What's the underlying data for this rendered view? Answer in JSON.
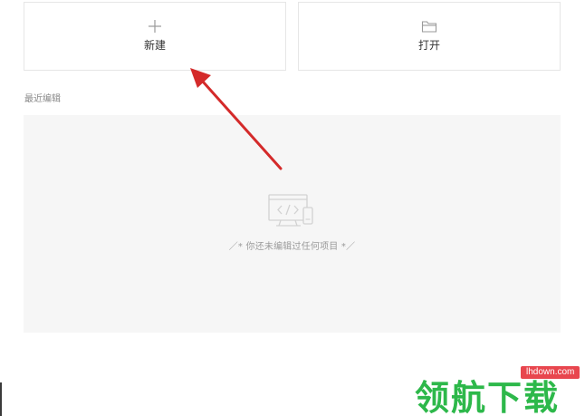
{
  "actions": {
    "new_label": "新建",
    "open_label": "打开"
  },
  "recent": {
    "title": "最近编辑",
    "empty_text": "／* 你还未编辑过任何项目 *／"
  },
  "watermark": {
    "brand": "领航下载",
    "url": "lhdown.com"
  },
  "colors": {
    "arrow": "#d42a2a",
    "watermark_green": "#2db84a",
    "watermark_red": "#e8464e",
    "panel_bg": "#f6f6f6",
    "border": "#e6e6e6"
  },
  "icons": {
    "new": "plus-icon",
    "open": "folder-icon",
    "empty": "code-screen-illustration-icon"
  }
}
